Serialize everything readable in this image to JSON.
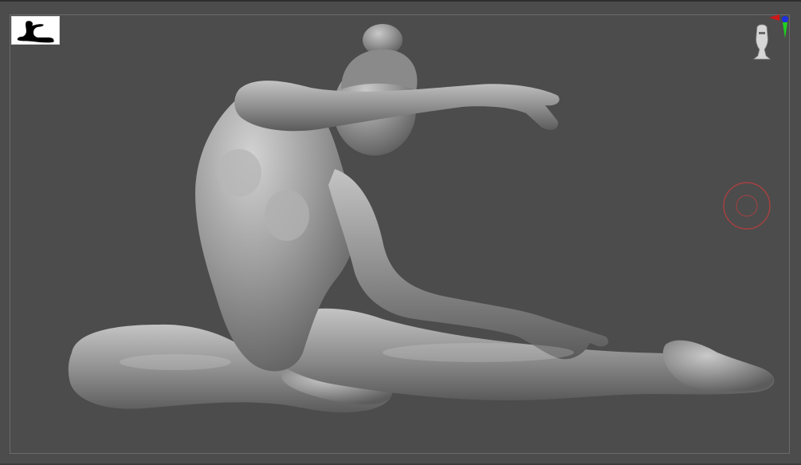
{
  "viewport": {
    "label": "",
    "background_color": "#4c4c4c"
  },
  "icons": {
    "thumbnail": "dancer-silhouette-icon",
    "gizmo": "head-orientation-gizmo-icon",
    "axis_x_color": "#d01818",
    "axis_y_color": "#1fd01f",
    "axis_z_color": "#1e2fe0",
    "brush": "brush-cursor-icon",
    "brush_color": "#a84040"
  },
  "model": {
    "subject": "sculpted-figure",
    "material_color": "#8e8e8e"
  }
}
